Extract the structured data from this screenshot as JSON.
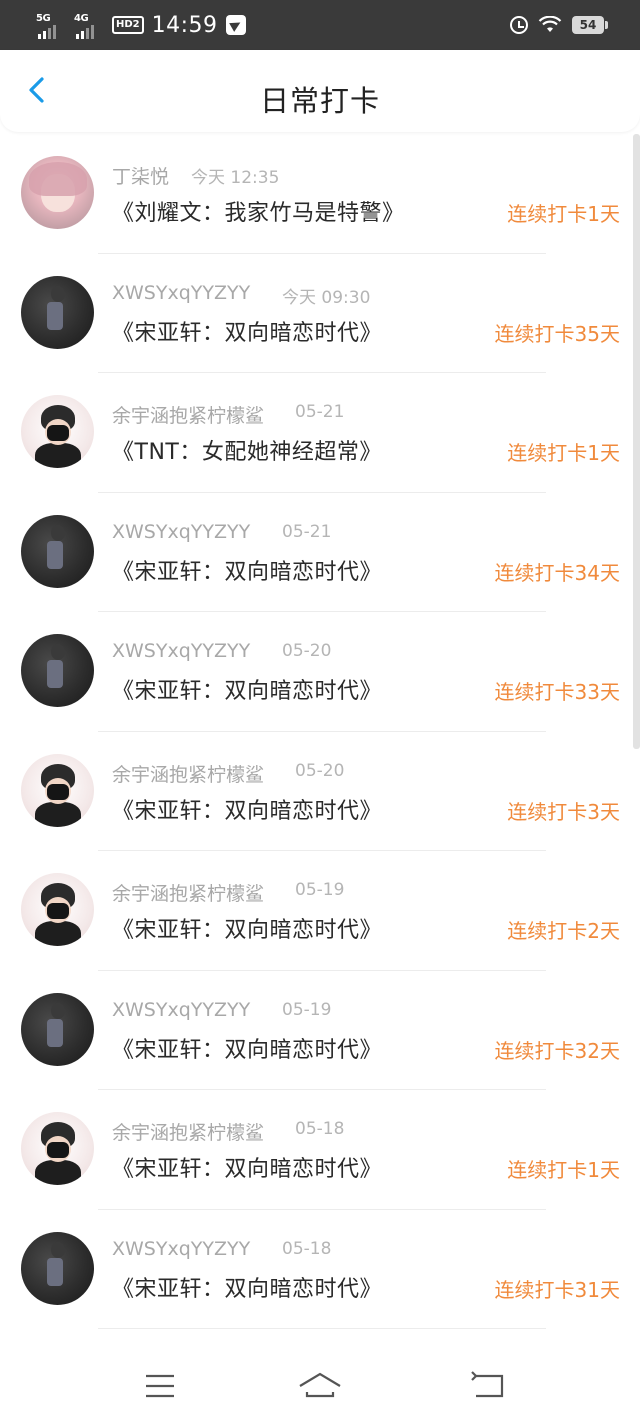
{
  "status_bar": {
    "signal1_label": "5G",
    "signal2_label": "4G",
    "hd_label": "HD2",
    "time": "14:59",
    "battery": "54"
  },
  "header": {
    "title": "日常打卡",
    "back_icon": "chevron-left-icon"
  },
  "colors": {
    "accent": "#1a9be8",
    "streak": "#f08a3c",
    "meta": "#a8a8a8"
  },
  "items": [
    {
      "user": "丁柒悦",
      "time": "今天 12:35",
      "book": "《刘耀文：我家竹马是特警》",
      "streak": "连续打卡1天",
      "avatar": "a"
    },
    {
      "user": "XWSYxqYYZYY",
      "time": "今天 09:30",
      "book": "《宋亚轩：双向暗恋时代》",
      "streak": "连续打卡35天",
      "avatar": "b"
    },
    {
      "user": "余宇涵抱紧柠檬鲨",
      "time": "05-21",
      "book": "《TNT：女配她神经超常》",
      "streak": "连续打卡1天",
      "avatar": "c"
    },
    {
      "user": "XWSYxqYYZYY",
      "time": "05-21",
      "book": "《宋亚轩：双向暗恋时代》",
      "streak": "连续打卡34天",
      "avatar": "b"
    },
    {
      "user": "XWSYxqYYZYY",
      "time": "05-20",
      "book": "《宋亚轩：双向暗恋时代》",
      "streak": "连续打卡33天",
      "avatar": "b"
    },
    {
      "user": "余宇涵抱紧柠檬鲨",
      "time": "05-20",
      "book": "《宋亚轩：双向暗恋时代》",
      "streak": "连续打卡3天",
      "avatar": "c"
    },
    {
      "user": "余宇涵抱紧柠檬鲨",
      "time": "05-19",
      "book": "《宋亚轩：双向暗恋时代》",
      "streak": "连续打卡2天",
      "avatar": "c"
    },
    {
      "user": "XWSYxqYYZYY",
      "time": "05-19",
      "book": "《宋亚轩：双向暗恋时代》",
      "streak": "连续打卡32天",
      "avatar": "b"
    },
    {
      "user": "余宇涵抱紧柠檬鲨",
      "time": "05-18",
      "book": "《宋亚轩：双向暗恋时代》",
      "streak": "连续打卡1天",
      "avatar": "c"
    },
    {
      "user": "XWSYxqYYZYY",
      "time": "05-18",
      "book": "《宋亚轩：双向暗恋时代》",
      "streak": "连续打卡31天",
      "avatar": "b"
    }
  ],
  "nav": {
    "menu_icon": "menu-icon",
    "home_icon": "home-icon",
    "back_icon": "back-icon"
  }
}
